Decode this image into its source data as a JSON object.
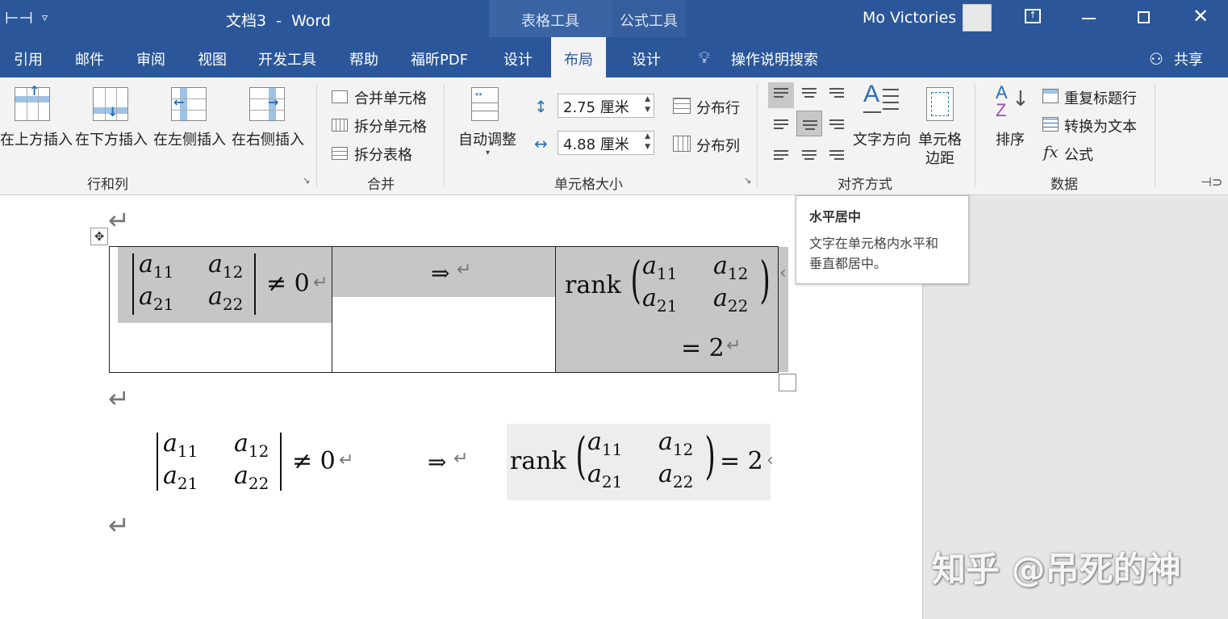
{
  "title_bar": {
    "doc_title": "文档3  -  Word",
    "context_groups": [
      "表格工具",
      "公式工具"
    ],
    "user_name": "Mo Victories",
    "controls": [
      "ribbon-display-icon",
      "minimize-icon",
      "restore-icon",
      "close-icon"
    ]
  },
  "tabs": {
    "left": [
      "引用",
      "邮件",
      "审阅",
      "视图",
      "开发工具",
      "帮助",
      "福昕PDF"
    ],
    "table_tools": [
      "设计",
      "布局"
    ],
    "equation_tools": [
      "设计"
    ],
    "active": "布局",
    "tell_me": "操作说明搜索",
    "share": "共享"
  },
  "ribbon": {
    "rows_cols": {
      "buttons": [
        "在上方插入",
        "在下方插入",
        "在左侧插入",
        "在右侧插入"
      ],
      "label": "行和列"
    },
    "merge": {
      "buttons": [
        "合并单元格",
        "拆分单元格",
        "拆分表格"
      ],
      "label": "合并"
    },
    "cell_size": {
      "autofit": "自动调整",
      "height": "2.75 厘米",
      "width": "4.88 厘米",
      "distribute_rows": "分布行",
      "distribute_cols": "分布列",
      "label": "单元格大小"
    },
    "alignment": {
      "text_direction": "文字方向",
      "cell_margins_line1": "单元格",
      "cell_margins_line2": "边距",
      "label": "对齐方式",
      "selected_index": 4
    },
    "data": {
      "sort": "排序",
      "repeat_header": "重复标题行",
      "convert_to_text": "转换为文本",
      "formula": "公式",
      "label": "数据"
    }
  },
  "tooltip": {
    "title": "水平居中",
    "body_line1": "文字在单元格内水平和",
    "body_line2": "垂直都居中。"
  },
  "document": {
    "table_row": {
      "cell1": {
        "m11": "a",
        "s11": "11",
        "m12": "a",
        "s12": "12",
        "m21": "a",
        "s21": "21",
        "m22": "a",
        "s22": "22",
        "rel": "≠ 0"
      },
      "cell2": {
        "arrow": "⇒"
      },
      "cell3": {
        "op": "rank",
        "m11": "a",
        "s11": "11",
        "m12": "a",
        "s12": "12",
        "m21": "a",
        "s21": "21",
        "m22": "a",
        "s22": "22",
        "rel": "= 2"
      }
    },
    "line": {
      "expr1": {
        "m11": "a",
        "s11": "11",
        "m12": "a",
        "s12": "12",
        "m21": "a",
        "s21": "21",
        "m22": "a",
        "s22": "22",
        "rel": "≠ 0"
      },
      "arrow": "⇒",
      "expr3": {
        "op": "rank",
        "m11": "a",
        "s11": "11",
        "m12": "a",
        "s12": "12",
        "m21": "a",
        "s21": "21",
        "m22": "a",
        "s22": "22",
        "rel": "= 2"
      }
    },
    "return_mark": "↵"
  },
  "watermark": "知乎 @吊死的神"
}
